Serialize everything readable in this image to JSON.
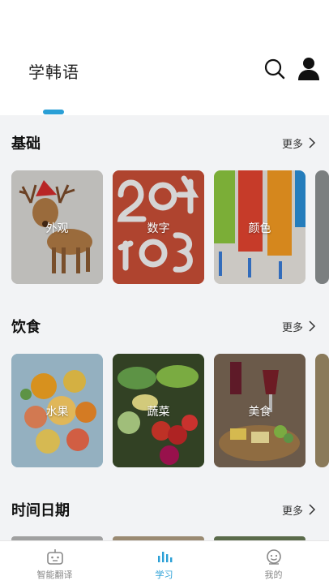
{
  "header": {
    "title": "学韩语",
    "accent_color": "#2a9fd6",
    "search_icon": "search-icon",
    "user_icon": "user-icon"
  },
  "sections": [
    {
      "title": "基础",
      "more_label": "更多",
      "cards": [
        {
          "label": "外观"
        },
        {
          "label": "数字"
        },
        {
          "label": "颜色"
        }
      ]
    },
    {
      "title": "饮食",
      "more_label": "更多",
      "cards": [
        {
          "label": "水果"
        },
        {
          "label": "蔬菜"
        },
        {
          "label": "美食"
        }
      ]
    },
    {
      "title": "时间日期",
      "more_label": "更多"
    }
  ],
  "tabbar": {
    "items": [
      {
        "label": "智能翻译",
        "icon": "robot-icon",
        "active": false
      },
      {
        "label": "学习",
        "icon": "bar-chart-icon",
        "active": true
      },
      {
        "label": "我的",
        "icon": "smiley-icon",
        "active": false
      }
    ]
  }
}
